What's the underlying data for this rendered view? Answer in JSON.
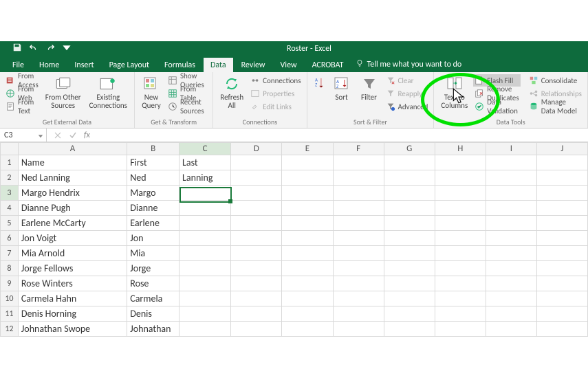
{
  "window": {
    "title": "Roster - Excel"
  },
  "tabs": {
    "file": "File",
    "home": "Home",
    "insert": "Insert",
    "page_layout": "Page Layout",
    "formulas": "Formulas",
    "data": "Data",
    "review": "Review",
    "view": "View",
    "acrobat": "ACROBAT",
    "tellme": "Tell me what you want to do"
  },
  "ribbon": {
    "get_external": {
      "from_access": "From Access",
      "from_web": "From Web",
      "from_text": "From Text",
      "from_other": "From Other\nSources",
      "existing": "Existing\nConnections",
      "label": "Get External Data"
    },
    "get_transform": {
      "new_query": "New\nQuery",
      "show_queries": "Show Queries",
      "from_table": "From Table",
      "recent_sources": "Recent Sources",
      "label": "Get & Transform"
    },
    "connections": {
      "refresh_all": "Refresh\nAll",
      "connections": "Connections",
      "properties": "Properties",
      "edit_links": "Edit Links",
      "label": "Connections"
    },
    "sort_filter": {
      "sort": "Sort",
      "filter": "Filter",
      "clear": "Clear",
      "reapply": "Reapply",
      "advanced": "Advanced",
      "label": "Sort & Filter"
    },
    "data_tools": {
      "text_to_columns": "Text to\nColumns",
      "flash_fill": "Flash Fill",
      "remove_duplicates": "Remove Duplicates",
      "data_validation": "Data Validation",
      "consolidate": "Consolidate",
      "relationships": "Relationships",
      "manage_model": "Manage Data Model",
      "label": "Data Tools"
    }
  },
  "namebox": "C3",
  "fx_label": "fx",
  "columns": [
    "A",
    "B",
    "C",
    "D",
    "E",
    "F",
    "G",
    "H",
    "I",
    "J"
  ],
  "rows": [
    {
      "n": "1",
      "A": "Name",
      "B": "First",
      "C": "Last"
    },
    {
      "n": "2",
      "A": "Ned Lanning",
      "B": "Ned",
      "C": "Lanning"
    },
    {
      "n": "3",
      "A": "Margo Hendrix",
      "B": "Margo",
      "C": ""
    },
    {
      "n": "4",
      "A": "Dianne Pugh",
      "B": "Dianne",
      "C": ""
    },
    {
      "n": "5",
      "A": "Earlene McCarty",
      "B": "Earlene",
      "C": ""
    },
    {
      "n": "6",
      "A": "Jon Voigt",
      "B": "Jon",
      "C": ""
    },
    {
      "n": "7",
      "A": "Mia Arnold",
      "B": "Mia",
      "C": ""
    },
    {
      "n": "8",
      "A": "Jorge Fellows",
      "B": "Jorge",
      "C": ""
    },
    {
      "n": "9",
      "A": "Rose Winters",
      "B": "Rose",
      "C": ""
    },
    {
      "n": "10",
      "A": "Carmela Hahn",
      "B": "Carmela",
      "C": ""
    },
    {
      "n": "11",
      "A": "Denis Horning",
      "B": "Denis",
      "C": ""
    },
    {
      "n": "12",
      "A": "Johnathan Swope",
      "B": "Johnathan",
      "C": ""
    }
  ],
  "selected_cell": {
    "col": "C",
    "row": 3
  }
}
